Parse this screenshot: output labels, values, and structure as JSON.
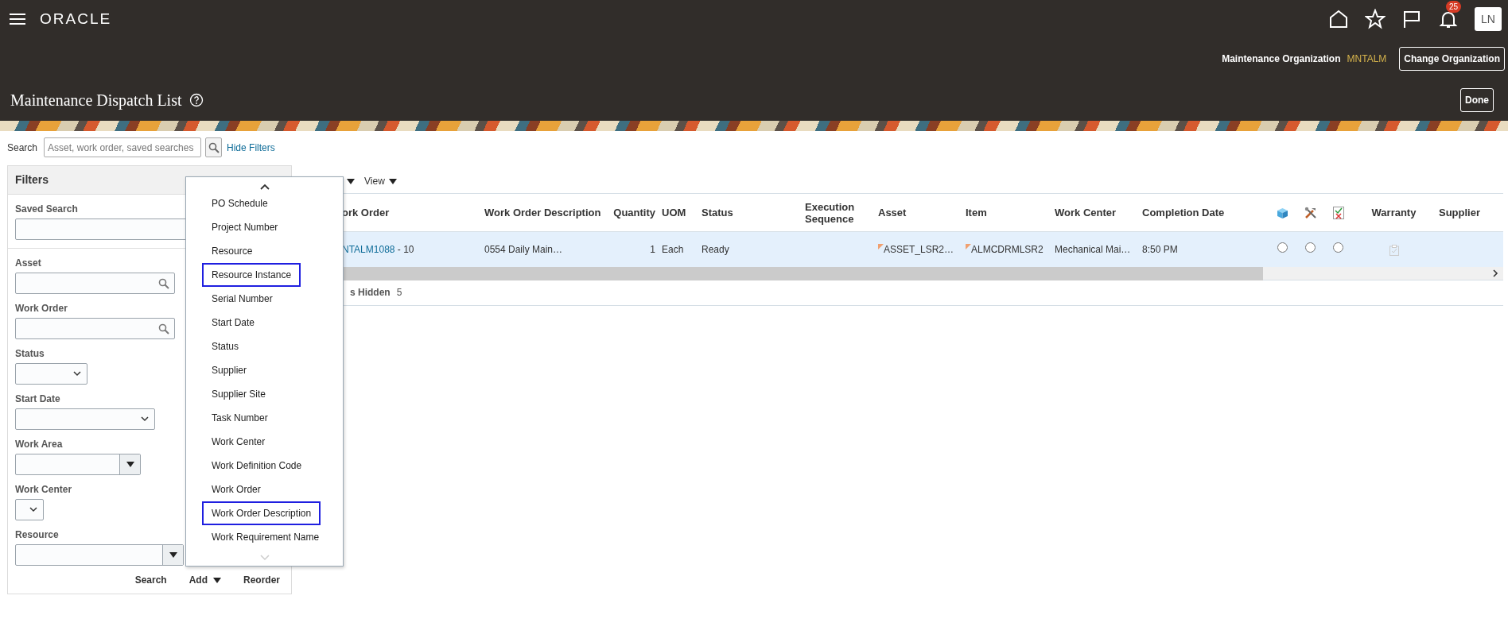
{
  "header": {
    "logo": "ORACLE",
    "notifications": "25",
    "avatar": "LN",
    "org_label": "Maintenance Organization",
    "org_value": "MNTALM",
    "change_org": "Change Organization"
  },
  "page": {
    "title": "Maintenance Dispatch List",
    "done": "Done"
  },
  "search": {
    "label": "Search",
    "placeholder": "Asset, work order, saved searches",
    "hide_filters": "Hide Filters"
  },
  "filters": {
    "title": "Filters",
    "fields": [
      {
        "label": "Saved Search",
        "kind": "text"
      },
      {
        "label": "Asset",
        "kind": "lookup"
      },
      {
        "label": "Work Order",
        "kind": "lookup"
      },
      {
        "label": "Status",
        "kind": "select"
      },
      {
        "label": "Start Date",
        "kind": "select"
      },
      {
        "label": "Work Area",
        "kind": "combo"
      },
      {
        "label": "Work Center",
        "kind": "select"
      },
      {
        "label": "Resource",
        "kind": "combo"
      }
    ],
    "footer": [
      {
        "label": "Search",
        "kind": "plain"
      },
      {
        "label": "Add",
        "kind": "menu"
      },
      {
        "label": "Reorder",
        "kind": "plain"
      }
    ]
  },
  "add_menu": {
    "items": [
      {
        "label": "PO Schedule",
        "highlighted": false
      },
      {
        "label": "Project Number",
        "highlighted": false
      },
      {
        "label": "Resource",
        "highlighted": false
      },
      {
        "label": "Resource Instance",
        "highlighted": true
      },
      {
        "label": "Serial Number",
        "highlighted": false
      },
      {
        "label": "Start Date",
        "highlighted": false
      },
      {
        "label": "Status",
        "highlighted": false
      },
      {
        "label": "Supplier",
        "highlighted": false
      },
      {
        "label": "Supplier Site",
        "highlighted": false
      },
      {
        "label": "Task Number",
        "highlighted": false
      },
      {
        "label": "Work Center",
        "highlighted": false
      },
      {
        "label": "Work Definition Code",
        "highlighted": false
      },
      {
        "label": "Work Order",
        "highlighted": false
      },
      {
        "label": "Work Order Description",
        "highlighted": true
      },
      {
        "label": "Work Requirement Name",
        "highlighted": false
      }
    ]
  },
  "table": {
    "view": "View",
    "columns": [
      {
        "kind": "text",
        "label": "ork Order"
      },
      {
        "kind": "text",
        "label": "Work Order Description"
      },
      {
        "kind": "number",
        "label": "Quantity"
      },
      {
        "kind": "text",
        "label": "UOM"
      },
      {
        "kind": "text",
        "label": "Status"
      },
      {
        "kind": "text",
        "label": "Execution Sequence"
      },
      {
        "kind": "text",
        "label": "Asset"
      },
      {
        "kind": "text",
        "label": "Item"
      },
      {
        "kind": "text",
        "label": "Work Center"
      },
      {
        "kind": "text",
        "label": "Completion Date"
      },
      {
        "kind": "cube"
      },
      {
        "kind": "tools"
      },
      {
        "kind": "check"
      },
      {
        "kind": "flag",
        "label": "Warranty"
      },
      {
        "kind": "text",
        "label": "Supplier"
      }
    ],
    "rows": [
      {
        "selected": true,
        "cells": [
          {
            "kind": "link",
            "link": "NTALM1088",
            "text": " - 10"
          },
          {
            "kind": "text",
            "text": "0554 Daily Main…"
          },
          {
            "kind": "text",
            "text": "1"
          },
          {
            "kind": "text",
            "text": "Each"
          },
          {
            "kind": "text",
            "text": "Ready"
          },
          {
            "kind": "empty"
          },
          {
            "kind": "flagged",
            "text": "ASSET_LSR2…"
          },
          {
            "kind": "flagged",
            "text": "ALMCDRMLSR2"
          },
          {
            "kind": "text",
            "text": "Mechanical Mai…"
          },
          {
            "kind": "text",
            "text": "8:50 PM"
          },
          {
            "kind": "radio",
            "checked": false
          },
          {
            "kind": "radio",
            "checked": false
          },
          {
            "kind": "radio",
            "checked": false
          },
          {
            "kind": "warranty"
          },
          {
            "kind": "empty"
          }
        ]
      }
    ],
    "hidden_label": "s Hidden",
    "hidden_count": "5"
  }
}
